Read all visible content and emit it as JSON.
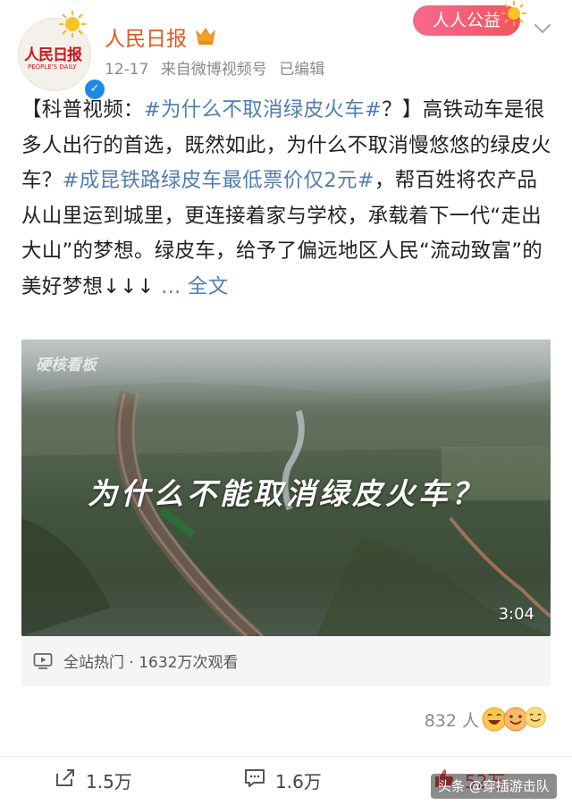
{
  "header": {
    "avatar_logo": "人民日报",
    "avatar_logo_sub": "PEOPLE'S DAILY",
    "account_name": "人民日报",
    "timestamp": "12-17",
    "source": "来自微博视频号",
    "edited": "已编辑",
    "badge_label": "人人公益"
  },
  "post": {
    "seg1": "【科普视频：",
    "tag1": "#为什么不取消绿皮火车#",
    "seg2": "？】高铁动车是很多人出行的首选，既然如此，为什么不取消慢悠悠的绿皮火车？",
    "tag2": "#成昆铁路绿皮车最低票价仅2元#",
    "seg3": "，帮百姓将农产品从山里运到城里，更连接着家与学校，承载着下一代“走出大山”的梦想。绿皮车，给予了偏远地区人民“流动致富”的美好梦想↓↓↓ ",
    "more": "... 全文"
  },
  "video": {
    "watermark": "硬核看板",
    "caption": "为什么不能取消绿皮火车？",
    "duration": "3:04",
    "bar_label": "全站热门 · 1632万次观看"
  },
  "reactions": {
    "count": "832 人"
  },
  "actions": {
    "repost": "1.5万",
    "comment": "1.6万",
    "like": "52万"
  },
  "footer_watermark": "头条 @穿插游击队",
  "colors": {
    "name": "#e0591f",
    "link": "#507daf",
    "badge": "#f2545b",
    "verified": "#1e8ae8",
    "like": "#e8524f"
  }
}
